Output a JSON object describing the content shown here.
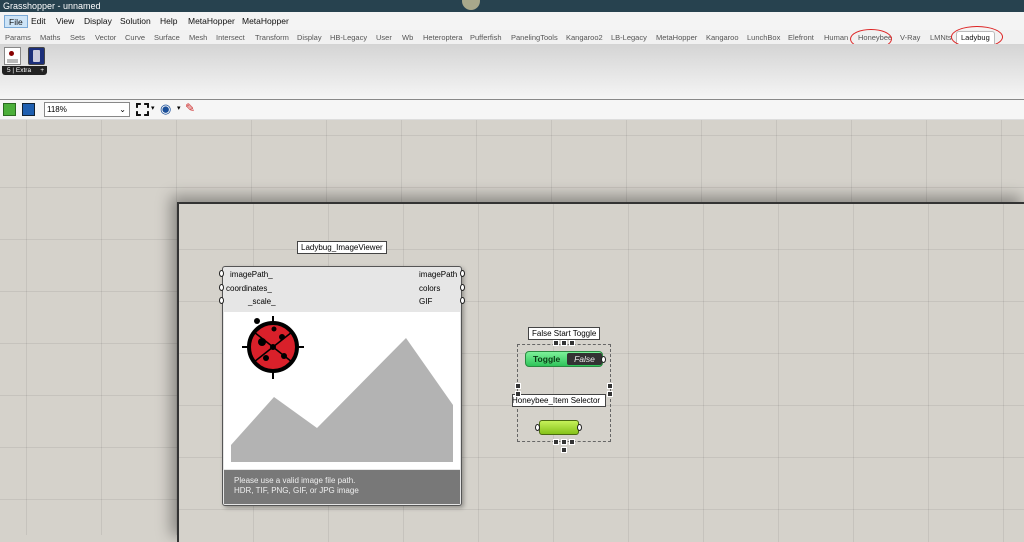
{
  "window": {
    "title": "Grasshopper - unnamed"
  },
  "menu": [
    "File",
    "Edit",
    "View",
    "Display",
    "Solution",
    "Help",
    "MetaHopper",
    "MetaHopper"
  ],
  "tabs": [
    "Params",
    "Maths",
    "Sets",
    "Vector",
    "Curve",
    "Surface",
    "Mesh",
    "Intersect",
    "Transform",
    "Display",
    "HB-Legacy",
    "User",
    "Wb",
    "Heteroptera",
    "Pufferfish",
    "PanelingTools",
    "Kangaroo2",
    "LB-Legacy",
    "MetaHopper",
    "Kangaroo",
    "LunchBox",
    "Elefront",
    "Human",
    "Honeybee",
    "V-Ray",
    "LMNts",
    "Ladybug"
  ],
  "selected_tab": "Ladybug",
  "ribbon": {
    "group_label": "5 | Extra",
    "expand": "+"
  },
  "toolbar": {
    "zoom": "118%"
  },
  "image_viewer": {
    "title": "Ladybug_ImageViewer",
    "inputs": [
      "imagePath_",
      "coordinates_",
      "_scale_"
    ],
    "outputs": [
      "imagePath",
      "colors",
      "GIF"
    ],
    "message_line1": "Please use a valid image file path.",
    "message_line2": "HDR, TIF, PNG, GIF, or JPG image"
  },
  "toggle": {
    "title": "False Start Toggle",
    "label": "Toggle",
    "value": "False"
  },
  "selector": {
    "title": "Honeybee_Item Selector"
  },
  "colors": {
    "titlebar": "#27424f",
    "toggle_green": "#3fd36a",
    "selector_green": "#9ad42a",
    "ladybug_red": "#d9202a",
    "annotation_red": "#dd2222"
  }
}
